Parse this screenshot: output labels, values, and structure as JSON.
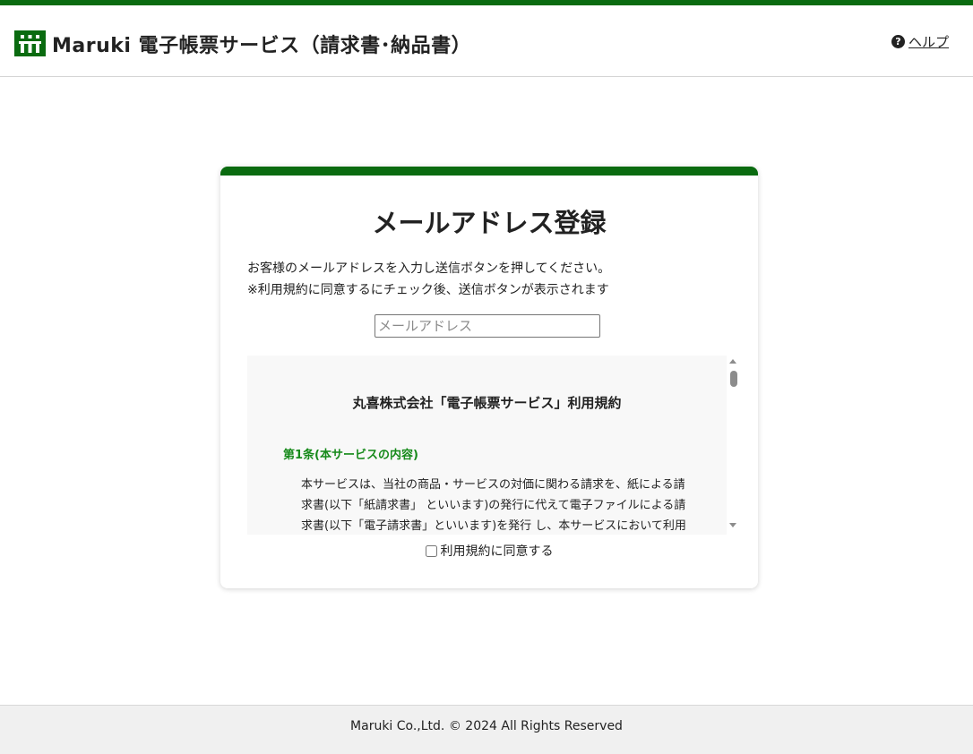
{
  "header": {
    "title": "Maruki 電子帳票サービス（請求書･納品書）",
    "help_label": "ヘルプ",
    "help_icon_glyph": "?",
    "logo_icon": "maruki-logo-icon"
  },
  "card": {
    "title": "メールアドレス登録",
    "instruction_line1": "お客様のメールアドレスを入力し送信ボタンを押してください。",
    "instruction_line2": "※利用規約に同意するにチェック後、送信ボタンが表示されます",
    "email_placeholder": "メールアドレス",
    "email_value": "",
    "terms": {
      "heading": "丸喜株式会社「電子帳票サービス」利用規約",
      "article1_title": "第1条(本サービスの内容)",
      "article1_line1": "本サービスは、当社の商品・サービスの対価に関わる請求を、紙による請",
      "article1_line2": "求書(以下「紙請求書」 といいます)の発行に代えて電子ファイルによる請",
      "article1_line3": "求書(以下「電子請求書」といいます)を発行 し、本サービスにおいて利用"
    },
    "agree_label": "利用規約に同意する",
    "agree_checked": false
  },
  "footer": {
    "copyright": "Maruki Co.,Ltd. © 2024 All Rights Reserved"
  },
  "colors": {
    "brand_green": "#0a6b10",
    "article_green": "#168a1a",
    "footer_bg": "#f0f0f0"
  }
}
